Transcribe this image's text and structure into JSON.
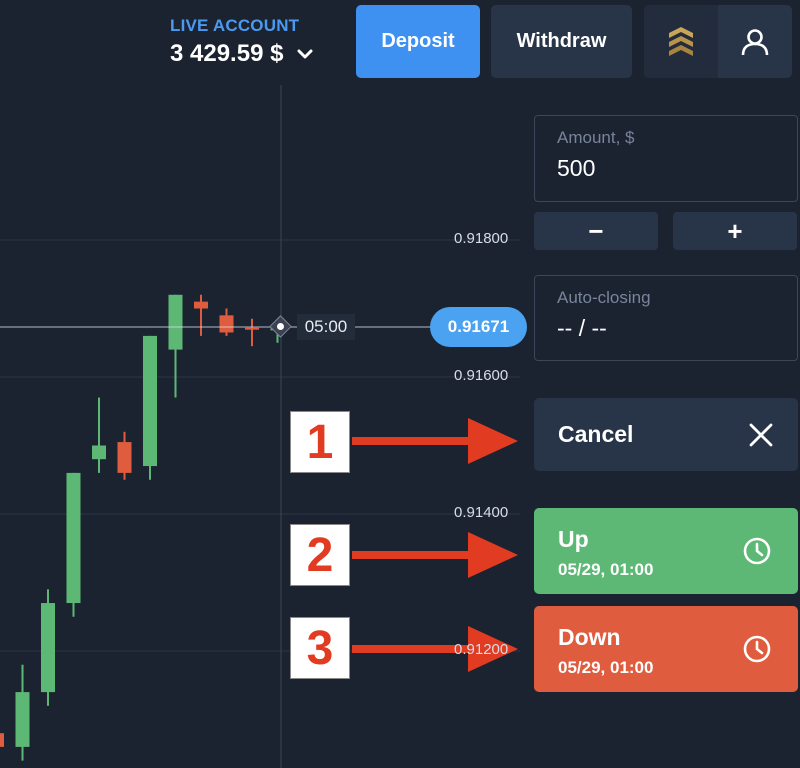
{
  "header": {
    "account_type": "LIVE ACCOUNT",
    "balance": "3 429.59 $",
    "deposit_label": "Deposit",
    "withdraw_label": "Withdraw",
    "icons": [
      "status-rank-icon",
      "user-icon"
    ]
  },
  "chart": {
    "price_levels": [
      "0.91800",
      "0.91600",
      "0.91400",
      "0.91200"
    ],
    "current_price": "0.91671",
    "timer": "05:00",
    "candles": [
      {
        "o": 0.9108,
        "c": 0.9106,
        "h": 0.911,
        "l": 0.9104
      },
      {
        "o": 0.9106,
        "c": 0.9114,
        "h": 0.9118,
        "l": 0.9104
      },
      {
        "o": 0.9114,
        "c": 0.9127,
        "h": 0.9129,
        "l": 0.9112
      },
      {
        "o": 0.9127,
        "c": 0.9146,
        "h": 0.9146,
        "l": 0.9125
      },
      {
        "o": 0.9148,
        "c": 0.915,
        "h": 0.9157,
        "l": 0.9146
      },
      {
        "o": 0.91505,
        "c": 0.9146,
        "h": 0.9152,
        "l": 0.9145
      },
      {
        "o": 0.9147,
        "c": 0.9166,
        "h": 0.9166,
        "l": 0.9145
      },
      {
        "o": 0.9164,
        "c": 0.9172,
        "h": 0.9172,
        "l": 0.9157
      },
      {
        "o": 0.9171,
        "c": 0.917,
        "h": 0.9172,
        "l": 0.9166
      },
      {
        "o": 0.9169,
        "c": 0.91665,
        "h": 0.917,
        "l": 0.9166
      },
      {
        "o": 0.91672,
        "c": 0.91671,
        "h": 0.91685,
        "l": 0.91645
      },
      {
        "o": 0.91671,
        "c": 0.91671,
        "h": 0.91678,
        "l": 0.9165
      }
    ],
    "up_color": "#5cb874",
    "down_color": "#e05c3e"
  },
  "trade": {
    "amount_label": "Amount, $",
    "amount_value": "500",
    "minus_label": "−",
    "plus_label": "+",
    "auto_closing_label": "Auto-closing",
    "auto_closing_value": "-- / --",
    "cancel_label": "Cancel",
    "up_label": "Up",
    "up_time": "05/29, 01:00",
    "down_label": "Down",
    "down_time": "05/29, 01:00"
  },
  "annotations": [
    "1",
    "2",
    "3"
  ],
  "colors": {
    "background": "#1b2331",
    "panel": "#283447",
    "accent_blue": "#3f91f1",
    "up": "#5cb874",
    "down": "#e05c3e",
    "annotation_red": "#e13b22"
  }
}
